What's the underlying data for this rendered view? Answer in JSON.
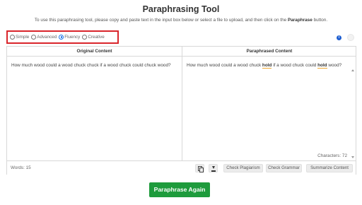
{
  "header": {
    "title": "Paraphrasing Tool",
    "subtitle_prefix": "To use this paraphrasing tool, please copy and paste text in the input box below or select a file to upload, and then click on the ",
    "subtitle_bold": "Paraphrase",
    "subtitle_suffix": " button."
  },
  "modes": {
    "items": [
      {
        "label": "Simple",
        "selected": false
      },
      {
        "label": "Advanced",
        "selected": false
      },
      {
        "label": "Fluency",
        "selected": true
      },
      {
        "label": "Creative",
        "selected": false
      }
    ],
    "highlight_color": "#d9252b"
  },
  "icons": {
    "info": "info-icon",
    "circle": "circle-icon",
    "copy": "copy-icon",
    "download": "download-icon"
  },
  "editor": {
    "left_header": "Original Content",
    "right_header": "Paraphrased Content",
    "original_text": "How much wood could a wood chuck chuck if a wood chuck could chuck wood?",
    "paraphrased": {
      "part1": "How much wood could a wood chuck ",
      "changed1": "hold",
      "part2": " if a wood chuck could ",
      "changed2": "hold",
      "part3": " wood?"
    },
    "characters_label": "Characters: 72"
  },
  "footer": {
    "words_label": "Words: 15",
    "check_plagiarism": "Check Plagiarism",
    "check_grammar": "Check Grammar",
    "summarize": "Summarize Content"
  },
  "actions": {
    "paraphrase_again": "Paraphrase Again",
    "primary_color": "#1e9b3c"
  }
}
